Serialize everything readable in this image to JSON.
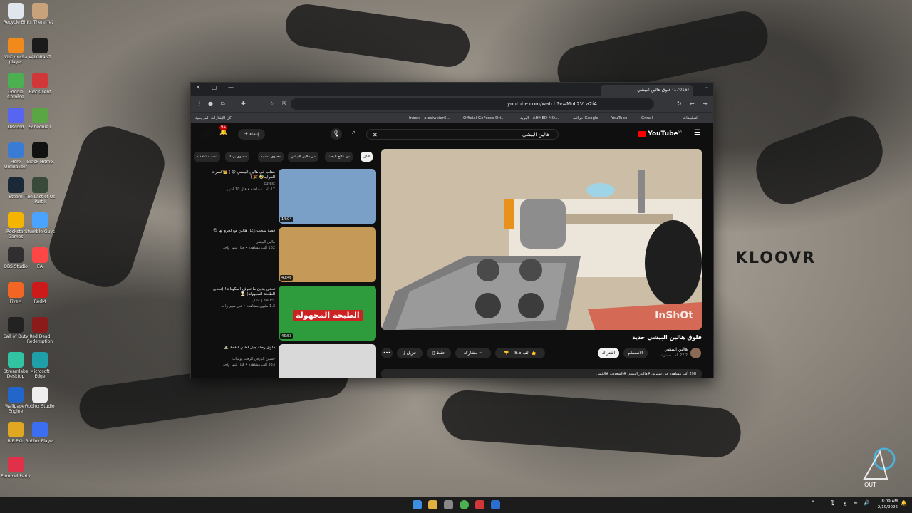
{
  "desktop": {
    "icons": [
      {
        "label": "Recycle Bin",
        "color": "#dfe6ee",
        "col": 0,
        "row": 0
      },
      {
        "label": "VLC media player",
        "color": "#f08a1a",
        "col": 0,
        "row": 1
      },
      {
        "label": "Google Chrome",
        "color": "#4caf50",
        "col": 0,
        "row": 2
      },
      {
        "label": "Discord",
        "color": "#5865f2",
        "col": 0,
        "row": 3
      },
      {
        "label": "Hero Unfinalizer",
        "color": "#3a7bd5",
        "col": 0,
        "row": 4
      },
      {
        "label": "Steam",
        "color": "#1b2838",
        "col": 0,
        "row": 5
      },
      {
        "label": "Rockstar Games",
        "color": "#f5b400",
        "col": 0,
        "row": 6
      },
      {
        "label": "OBS Studio",
        "color": "#302e31",
        "col": 0,
        "row": 7
      },
      {
        "label": "FiveM",
        "color": "#f26522",
        "col": 0,
        "row": 8
      },
      {
        "label": "Call of Duty",
        "color": "#222222",
        "col": 0,
        "row": 9
      },
      {
        "label": "Streamlabs Desktop",
        "color": "#31c3a2",
        "col": 0,
        "row": 10
      },
      {
        "label": "Wallpaper Engine",
        "color": "#2266cc",
        "col": 0,
        "row": 11
      },
      {
        "label": "R.E.P.O.",
        "color": "#e0a820",
        "col": 0,
        "row": 12
      },
      {
        "label": "Pummel Party",
        "color": "#e0304a",
        "col": 0,
        "row": 13
      },
      {
        "label": "Its There Yet",
        "color": "#c7a27a",
        "col": 1,
        "row": 0
      },
      {
        "label": "VALORANT",
        "color": "#1b1b1b",
        "col": 1,
        "row": 1
      },
      {
        "label": "Riot Client",
        "color": "#d13639",
        "col": 1,
        "row": 2
      },
      {
        "label": "Schedule I",
        "color": "#5aa645",
        "col": 1,
        "row": 3
      },
      {
        "label": "Black Hitmo",
        "color": "#111111",
        "col": 1,
        "row": 4
      },
      {
        "label": "The Last of Us Part I",
        "color": "#3a4a3a",
        "col": 1,
        "row": 5
      },
      {
        "label": "Stumble Guys",
        "color": "#4aa3ff",
        "col": 1,
        "row": 6
      },
      {
        "label": "EA",
        "color": "#ff4747",
        "col": 1,
        "row": 7
      },
      {
        "label": "RedM",
        "color": "#cc1a1a",
        "col": 1,
        "row": 8
      },
      {
        "label": "Red Dead Redemption",
        "color": "#8b1a1a",
        "col": 1,
        "row": 9
      },
      {
        "label": "Microsoft Edge",
        "color": "#1fa0a8",
        "col": 1,
        "row": 10
      },
      {
        "label": "Roblox Studio",
        "color": "#eeeeee",
        "col": 1,
        "row": 11
      },
      {
        "label": "Roblox Player",
        "color": "#3b6ef0",
        "col": 1,
        "row": 12
      }
    ],
    "watermark": "KLOOVR",
    "corner_logo_text": "OUT"
  },
  "browser": {
    "tab_title": "(17016) فلوق هالين البيشي",
    "url": "youtube.com/watch?v=MoIi2Vca2iA",
    "bookmarks": [
      "التطبيقات",
      "Gmail",
      "YouTube",
      "خرائط Google",
      "البريد - AHMED MO...",
      "Official GeForce Dri...",
      "Inbox – alosiweier6...",
      "كل الإشارات المرجعية"
    ]
  },
  "youtube": {
    "logo": "YouTube",
    "logo_badge": "SA",
    "search_value": "هالين البيشي",
    "create_label": "إنشاء",
    "notif_count": "9+",
    "chips": [
      {
        "label": "الكل",
        "active": true
      },
      {
        "label": "من نتائج البحث",
        "active": false
      },
      {
        "label": "من هالين البيشي",
        "active": false
      },
      {
        "label": "محتوى مشابه",
        "active": false
      },
      {
        "label": "محتوى يهمك",
        "active": false
      },
      {
        "label": "تمت مشاهدته",
        "active": false
      }
    ],
    "recommendations": [
      {
        "title": "مقلب في هالين البيشي 😡 ) 👑كسرت المرايه🤣 🎉 (",
        "channel": "cutest",
        "meta": "17 ألف مشاهدة • قبل 10 أشهر",
        "duration": "14:04",
        "thumb": "#7aa0c8"
      },
      {
        "title": "قصة سجب زعل هالين مع لجرو لها 😍",
        "channel": "هالين البيشي",
        "meta": "162 ألف مشاهدة • قبل شهر واحد",
        "duration": "40:46",
        "thumb": "#c59a58"
      },
      {
        "title": "تحدي بدون ما تعرف المكونات! (تحدي الطبخة المجهولة) 👨‍🍳",
        "channel": "3ADEL | عادل",
        "meta": "1.2 مليون مشاهدة • قبل شهر واحد",
        "duration": "46:53",
        "thumb": "#2e9c3c",
        "thumb_text": "الطبخة المجهولة"
      },
      {
        "title": "فلوق رحلة جبل اطلي القمة ⛰️",
        "channel": "حسين البارقي الرقت يوميات",
        "meta": "333 ألف مشاهدة • قبل شهر واحد",
        "duration": "",
        "thumb": "#d9d9d9"
      }
    ],
    "video": {
      "title": "فلوق هالين البيشي جديد",
      "overlay_text": "InShOt",
      "channel_name": "هالين البيشي",
      "subscribers": "22.2 ألف مشترك",
      "join_label": "الانضمام",
      "subscribe_label": "اشتراك",
      "likes": "8.5 ألف",
      "share_label": "مشاركة",
      "save_label": "حفظ",
      "download_label": "تنزيل",
      "description": "298 ألف مشاهدة قبل شهرين #هالين_البيشي #السعودية #الكسل"
    }
  },
  "taskbar": {
    "time": "8:09 AM",
    "date": "2/10/2026"
  }
}
